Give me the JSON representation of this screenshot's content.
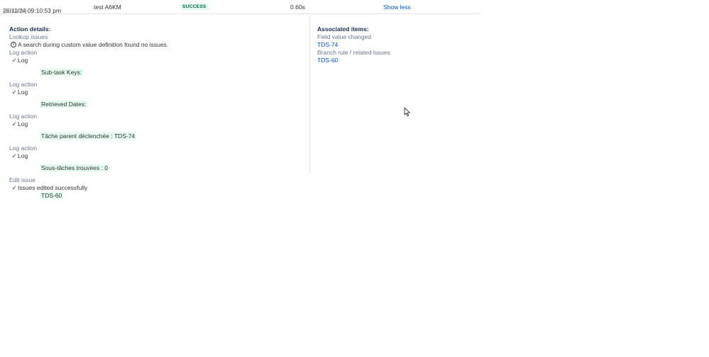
{
  "row": {
    "date": "26/11/24 09:10:53 pm",
    "id": "(606438)",
    "name": "test A6KM",
    "status": "SUCCESS",
    "duration": "0.60s",
    "toggle_label": "Show less"
  },
  "action_details": {
    "heading": "Action details:",
    "lookup": {
      "action": "Lookup issues",
      "message": "A search during custom value definition found no issues."
    },
    "logs": [
      {
        "action": "Log action",
        "message": "Log",
        "value": "Sub-task Keys:"
      },
      {
        "action": "Log action",
        "message": "Log",
        "value": "Retrieved Dates:"
      },
      {
        "action": "Log action",
        "message": "Log",
        "value": "Tâche parent déclenchée : TDS-74"
      },
      {
        "action": "Log action",
        "message": "Log",
        "value": "Sous-tâches trouvées : 0"
      }
    ],
    "edit": {
      "action": "Edit issue",
      "message": "Issues edited successfully",
      "value": "TDS-60"
    }
  },
  "associated_items": {
    "heading": "Associated items:",
    "groups": [
      {
        "label": "Field value changed",
        "link": "TDS-74"
      },
      {
        "label": "Branch rule / related issues",
        "link": "TDS-60"
      }
    ]
  },
  "icons": {
    "info": "info-icon",
    "check": "check-icon",
    "cursor": "mouse-pointer-icon"
  }
}
